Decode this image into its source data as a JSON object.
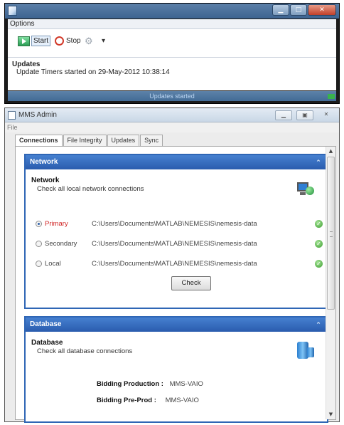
{
  "top_window": {
    "menu_label": "Options",
    "toolbar": {
      "start_label": "Start",
      "stop_label": "Stop"
    },
    "updates": {
      "heading": "Updates",
      "message": "Update Timers started on 29-May-2012 10:38:14"
    },
    "status_text": "Updates started"
  },
  "admin_window": {
    "title": "MMS Admin",
    "menu_file": "File",
    "tabs": [
      "Connections",
      "File Integrity",
      "Updates",
      "Sync"
    ],
    "active_tab": "Connections",
    "network_panel": {
      "header": "Network",
      "title": "Network",
      "description": "Check all local network connections",
      "locations": [
        {
          "label": "Primary",
          "path": "C:\\Users\\Documents\\MATLAB\\NEMESIS\\nemesis-data",
          "selected": true
        },
        {
          "label": "Secondary",
          "path": "C:\\Users\\Documents\\MATLAB\\NEMESIS\\nemesis-data",
          "selected": false
        },
        {
          "label": "Local",
          "path": "C:\\Users\\Documents\\MATLAB\\NEMESIS\\nemesis-data",
          "selected": false
        }
      ],
      "check_button": "Check"
    },
    "database_panel": {
      "header": "Database",
      "title": "Database",
      "description": "Check all database connections",
      "entries": [
        {
          "key": "Bidding Production :",
          "value": "MMS-VAIO"
        },
        {
          "key": "Bidding Pre-Prod :",
          "value": "MMS-VAIO"
        }
      ]
    }
  },
  "colors": {
    "panel_header": "#2f66b5",
    "primary_label": "#d02424",
    "status_bar": "#4a72a0"
  }
}
